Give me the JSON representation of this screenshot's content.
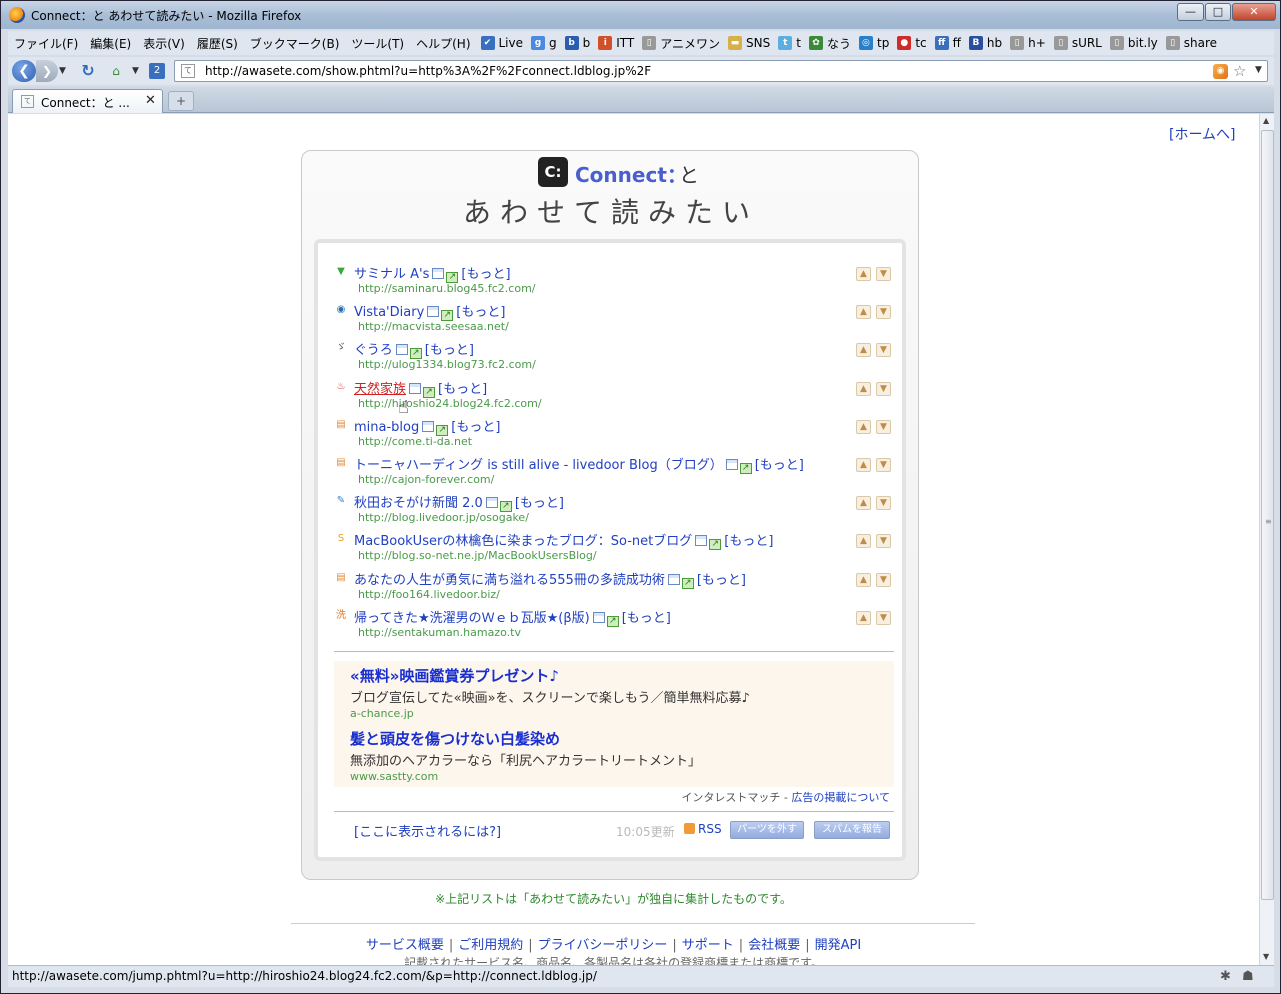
{
  "window": {
    "title": "Connect：と あわせて読みたい - Mozilla Firefox",
    "min_label": "—",
    "max_label": "□",
    "close_label": "✕"
  },
  "menu": [
    "ファイル(F)",
    "編集(E)",
    "表示(V)",
    "履歴(S)",
    "ブックマーク(B)",
    "ツール(T)",
    "ヘルプ(H)"
  ],
  "bookmarks": [
    {
      "label": "Live",
      "color": "#3a6fc0",
      "glyph": "✔"
    },
    {
      "label": "g",
      "color": "#4a8ae0",
      "glyph": "g"
    },
    {
      "label": "b",
      "color": "#2a5db0",
      "glyph": "b"
    },
    {
      "label": "ITT",
      "color": "#d0502a",
      "glyph": "i"
    },
    {
      "label": "アニメワン",
      "color": "#999999",
      "glyph": "▯"
    },
    {
      "label": "SNS",
      "color": "#d8b04a",
      "glyph": "▬"
    },
    {
      "label": "t",
      "color": "#5aaee0",
      "glyph": "t"
    },
    {
      "label": "なう",
      "color": "#3a8a3a",
      "glyph": "✿"
    },
    {
      "label": "tp",
      "color": "#2a80c8",
      "glyph": "◎"
    },
    {
      "label": "tc",
      "color": "#d02a2a",
      "glyph": "●"
    },
    {
      "label": "ff",
      "color": "#3a6fc0",
      "glyph": "ff"
    },
    {
      "label": "hb",
      "color": "#2a4fa0",
      "glyph": "B"
    },
    {
      "label": "h+",
      "color": "#999999",
      "glyph": "▯"
    },
    {
      "label": "sURL",
      "color": "#999999",
      "glyph": "▯"
    },
    {
      "label": "bit.ly",
      "color": "#999999",
      "glyph": "▯"
    },
    {
      "label": "share",
      "color": "#999999",
      "glyph": "▯"
    }
  ],
  "nav": {
    "url": "http://awasete.com/show.phtml?u=http%3A%2F%2Fconnect.ldblog.jp%2F",
    "back_glyph": "❮",
    "fwd_glyph": "❯",
    "reload_glyph": "↻"
  },
  "tab": {
    "label": "Connect：と ...",
    "close": "✕",
    "new": "+"
  },
  "page": {
    "home_link": "[ホームへ]",
    "blog_name": "Connect：",
    "to": "と",
    "logo_text": "C:",
    "service_name": "あわせて読みたい",
    "entries": [
      {
        "title": "サミナル A's",
        "url": "http://saminaru.blog45.fc2.com/",
        "fav_glyph": "▼",
        "fav_color": "#3aa83a"
      },
      {
        "title": "Vista'Diary",
        "url": "http://macvista.seesaa.net/",
        "fav_glyph": "◉",
        "fav_color": "#2a6fb0"
      },
      {
        "title": "ぐうろ",
        "url": "http://ulog1334.blog73.fc2.com/",
        "fav_glyph": "ゞ",
        "fav_color": "#555555"
      },
      {
        "title": "天然家族",
        "url": "http://hiroshio24.blog24.fc2.com/",
        "fav_glyph": "♨",
        "fav_color": "#d03030"
      },
      {
        "title": "mina-blog",
        "url": "http://come.ti-da.net",
        "fav_glyph": "▤",
        "fav_color": "#e08a3a"
      },
      {
        "title": "トーニャハーディング is still alive - livedoor Blog（ブログ）",
        "url": "http://cajon-forever.com/",
        "fav_glyph": "▤",
        "fav_color": "#e08a3a"
      },
      {
        "title": "秋田おそがけ新聞 2.0",
        "url": "http://blog.livedoor.jp/osogake/",
        "fav_glyph": "✎",
        "fav_color": "#3a7ad8"
      },
      {
        "title": "MacBookUserの林檎色に染まったブログ：So-netブログ",
        "url": "http://blog.so-net.ne.jp/MacBookUsersBlog/",
        "fav_glyph": "S",
        "fav_color": "#f0a020"
      },
      {
        "title": "あなたの人生が勇気に満ち溢れる555冊の多読成功術",
        "url": "http://foo164.livedoor.biz/",
        "fav_glyph": "▤",
        "fav_color": "#e08a3a"
      },
      {
        "title": "帰ってきた★洗濯男のＷｅｂ瓦版★(β版)",
        "url": "http://sentakuman.hamazo.tv",
        "fav_glyph": "洗",
        "fav_color": "#e07a2a"
      }
    ],
    "more_label": "[もっと]",
    "ads": [
      {
        "title": "«無料»映画鑑賞券プレゼント♪",
        "desc": "ブログ宣伝してた«映画»を、スクリーンで楽しもう／簡単無料応募♪",
        "url": "a-chance.jp"
      },
      {
        "title": "髪と頭皮を傷つけない白髪染め",
        "desc": "無添加のヘアカラーなら「利尻ヘアカラートリートメント」",
        "url": "www.sastty.com"
      }
    ],
    "ad_credit": "インタレストマッチ - ",
    "ad_credit_link": "広告の掲載について",
    "howto_link": "[ここに表示されるには?]",
    "updated": "10:05更新",
    "rss_label": "RSS",
    "remove_btn": "パーツを外す",
    "spam_btn": "スパムを報告",
    "note": "※上記リストは「あわせて読みたい」が独自に集計したものです。",
    "footer_links": [
      "サービス概要",
      "ご利用規約",
      "プライバシーポリシー",
      "サポート",
      "会社概要",
      "開発API"
    ],
    "footer_sep": "|",
    "footer_note": "記載されたサービス名、商品名、各製品名は各社の登録商標または商標です。"
  },
  "status": {
    "text": "http://awasete.com/jump.phtml?u=http://hiroshio24.blog24.fc2.com/&p=http://connect.ldblog.jp/"
  }
}
